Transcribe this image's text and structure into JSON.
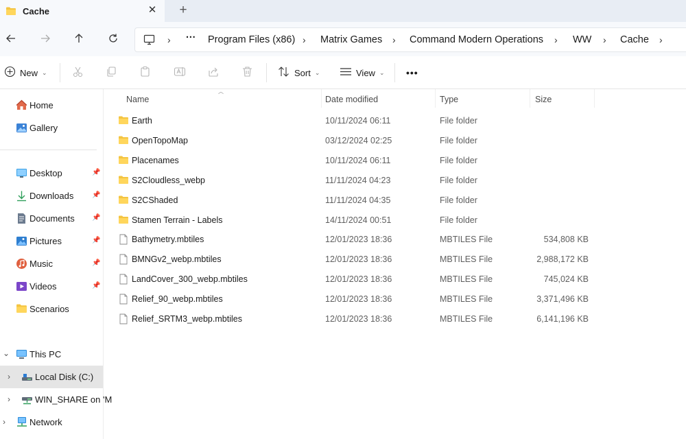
{
  "window": {
    "tab_title": "Cache",
    "tab_close": "✕",
    "new_tab": "+"
  },
  "nav": {
    "overflow": "···",
    "breadcrumbs": [
      "Program Files (x86)",
      "Matrix Games",
      "Command Modern Operations",
      "WW",
      "Cache"
    ],
    "separator": "›"
  },
  "toolbar": {
    "new_label": "New",
    "sort_label": "Sort",
    "view_label": "View",
    "more": "•••"
  },
  "sidebar": {
    "quick": [
      {
        "label": "Home",
        "icon": "home-icon"
      },
      {
        "label": "Gallery",
        "icon": "gallery-icon"
      }
    ],
    "pinned": [
      {
        "label": "Desktop",
        "icon": "desktop-icon"
      },
      {
        "label": "Downloads",
        "icon": "downloads-icon"
      },
      {
        "label": "Documents",
        "icon": "documents-icon"
      },
      {
        "label": "Pictures",
        "icon": "pictures-icon"
      },
      {
        "label": "Music",
        "icon": "music-icon"
      },
      {
        "label": "Videos",
        "icon": "videos-icon"
      },
      {
        "label": "Scenarios",
        "icon": "folder-icon"
      }
    ],
    "tree": [
      {
        "label": "This PC",
        "icon": "pc-icon"
      },
      {
        "label": "Local Disk (C:)",
        "icon": "drive-icon"
      },
      {
        "label": "WIN_SHARE on 'M",
        "icon": "network-drive-icon"
      },
      {
        "label": "Network",
        "icon": "network-icon"
      }
    ]
  },
  "columns": {
    "name": "Name",
    "date": "Date modified",
    "type": "Type",
    "size": "Size"
  },
  "files": [
    {
      "name": "Earth",
      "date": "10/11/2024 06:11",
      "type": "File folder",
      "size": "",
      "icon": "folder-icon"
    },
    {
      "name": "OpenTopoMap",
      "date": "03/12/2024 02:25",
      "type": "File folder",
      "size": "",
      "icon": "folder-icon"
    },
    {
      "name": "Placenames",
      "date": "10/11/2024 06:11",
      "type": "File folder",
      "size": "",
      "icon": "folder-icon"
    },
    {
      "name": "S2Cloudless_webp",
      "date": "11/11/2024 04:23",
      "type": "File folder",
      "size": "",
      "icon": "folder-icon"
    },
    {
      "name": "S2CShaded",
      "date": "11/11/2024 04:35",
      "type": "File folder",
      "size": "",
      "icon": "folder-icon"
    },
    {
      "name": "Stamen Terrain - Labels",
      "date": "14/11/2024 00:51",
      "type": "File folder",
      "size": "",
      "icon": "folder-icon"
    },
    {
      "name": "Bathymetry.mbtiles",
      "date": "12/01/2023 18:36",
      "type": "MBTILES File",
      "size": "534,808 KB",
      "icon": "file-icon"
    },
    {
      "name": "BMNGv2_webp.mbtiles",
      "date": "12/01/2023 18:36",
      "type": "MBTILES File",
      "size": "2,988,172 KB",
      "icon": "file-icon"
    },
    {
      "name": "LandCover_300_webp.mbtiles",
      "date": "12/01/2023 18:36",
      "type": "MBTILES File",
      "size": "745,024 KB",
      "icon": "file-icon"
    },
    {
      "name": "Relief_90_webp.mbtiles",
      "date": "12/01/2023 18:36",
      "type": "MBTILES File",
      "size": "3,371,496 KB",
      "icon": "file-icon"
    },
    {
      "name": "Relief_SRTM3_webp.mbtiles",
      "date": "12/01/2023 18:36",
      "type": "MBTILES File",
      "size": "6,141,196 KB",
      "icon": "file-icon"
    }
  ]
}
